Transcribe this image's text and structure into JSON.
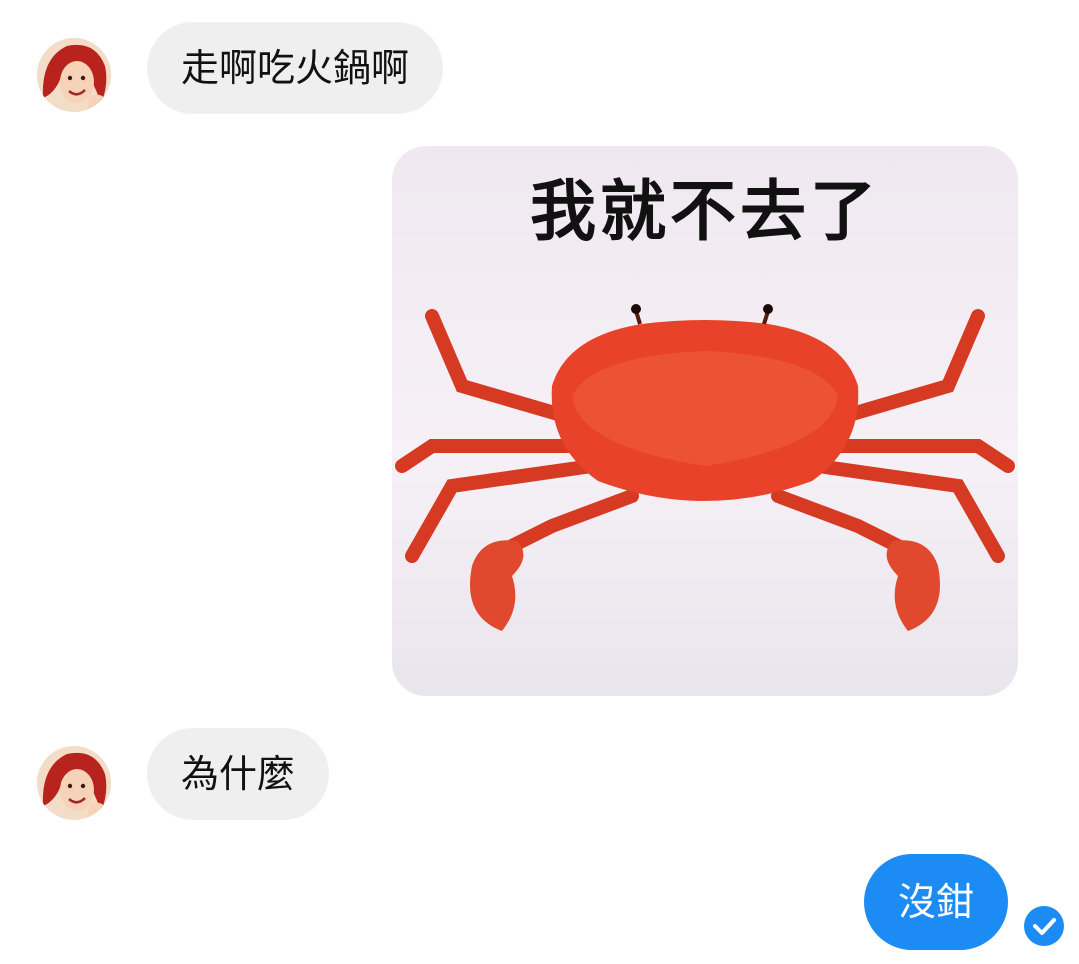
{
  "messages": [
    {
      "side": "incoming",
      "text": "走啊吃火鍋啊"
    },
    {
      "side": "outgoing",
      "type": "sticker",
      "caption": "我就不去了",
      "image": "crab"
    },
    {
      "side": "incoming",
      "text": "為什麼"
    },
    {
      "side": "outgoing",
      "text": "沒鉗",
      "status_icon": "read-check-icon"
    }
  ],
  "colors": {
    "incoming_bubble": "#efefef",
    "outgoing_bubble": "#1c8cf4",
    "crab": "#e8432a"
  }
}
